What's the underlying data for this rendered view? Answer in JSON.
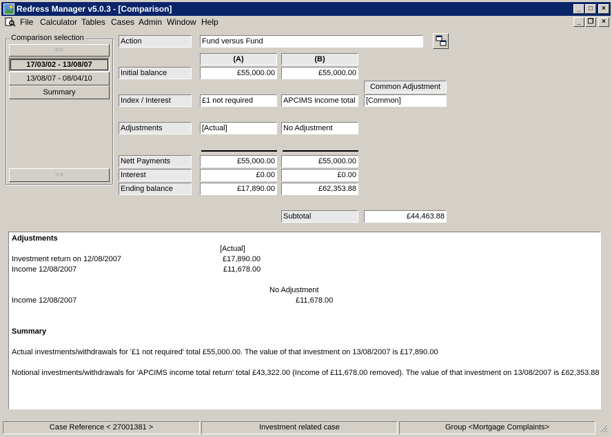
{
  "window": {
    "title": "Redress Manager v5.0.3 - [Comparison]"
  },
  "menu": {
    "items": [
      "File",
      "Calculator",
      "Tables",
      "Cases",
      "Admin",
      "Window",
      "Help"
    ]
  },
  "comparison_selection": {
    "legend": "Comparison selection",
    "prev_label": "<<",
    "next_label": ">>",
    "periods": [
      "17/03/02 - 13/08/07",
      "13/08/07 - 08/04/10"
    ],
    "summary_label": "Summary"
  },
  "form": {
    "action_label": "Action",
    "action_value": "Fund versus Fund",
    "col_a_header": "(A)",
    "col_b_header": "(B)",
    "common_adjustment_header": "Common Adjustment",
    "rows": {
      "initial_balance": {
        "label": "Initial balance",
        "a": "£55,000.00",
        "b": "£55,000.00"
      },
      "index_interest": {
        "label": "Index / Interest",
        "a": "£1 not required",
        "b": "APCIMS income total",
        "common": "[Common]"
      },
      "adjustments": {
        "label": "Adjustments",
        "a": "[Actual]",
        "b": "No Adjustment"
      },
      "nett_payments": {
        "label": "Nett Payments",
        "a": "£55,000.00",
        "b": "£55,000.00"
      },
      "interest": {
        "label": "Interest",
        "a": "£0.00",
        "b": "£0.00"
      },
      "ending_balance": {
        "label": "Ending balance",
        "a": "£17,890.00",
        "b": "£62,353.88"
      }
    },
    "subtotal_label": "Subtotal",
    "subtotal_value": "£44,463.88"
  },
  "report": {
    "adjustments_heading": "Adjustments",
    "actual_heading": "[Actual]",
    "actual_lines": [
      {
        "desc": "Investment return on 12/08/2007",
        "amount": "£17,890.00"
      },
      {
        "desc": "Income 12/08/2007",
        "amount": "£11,678.00"
      }
    ],
    "noadj_heading": "No Adjustment",
    "noadj_lines": [
      {
        "desc": "Income 12/08/2007",
        "amount": "£11,678.00"
      }
    ],
    "summary_heading": "Summary",
    "summary_line1": "Actual investments/withdrawals for '£1 not required' total £55,000.00. The value of that investment on 13/08/2007 is £17,890.00",
    "summary_line2": "Notional investments/withdrawals for 'APCIMS income total return' total £43,322.00 (Income of £11,678.00 removed). The value of that investment on 13/08/2007 is £62,353.88"
  },
  "statusbar": {
    "case_reference": "Case Reference < 27001381 >",
    "case_type": "Investment related case",
    "group": "Group <Mortgage Complaints>"
  }
}
